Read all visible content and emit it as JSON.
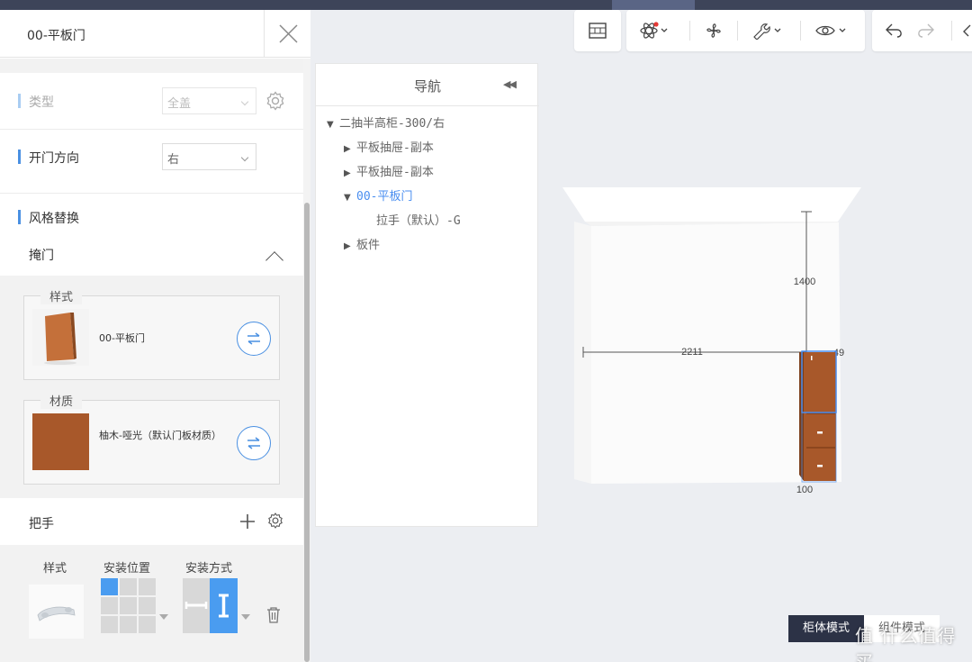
{
  "panel": {
    "title": "00-平板门",
    "rows": {
      "type": {
        "label": "类型",
        "value": "全盖"
      },
      "open_dir": {
        "label": "开门方向",
        "value": "右"
      },
      "style_replace": {
        "label": "风格替换"
      }
    },
    "overlay_door": {
      "label": "掩门"
    },
    "style_card": {
      "legend": "样式",
      "name": "00-平板门"
    },
    "material_card": {
      "legend": "材质",
      "name": "柚木-哑光（默认门板材质）"
    },
    "handle": {
      "label": "把手",
      "col_style": "样式",
      "col_position": "安装位置",
      "col_method": "安装方式"
    }
  },
  "nav": {
    "title": "导航",
    "items": [
      {
        "label": "二抽半高柜-300/右",
        "level": 0,
        "expanded": true
      },
      {
        "label": "平板抽屉-副本",
        "level": 1,
        "expanded": false
      },
      {
        "label": "平板抽屉-副本",
        "level": 1,
        "expanded": false
      },
      {
        "label": "00-平板门",
        "level": 1,
        "expanded": true,
        "active": true
      },
      {
        "label": "拉手（默认）-G",
        "level": 2
      },
      {
        "label": "板件",
        "level": 1,
        "expanded": false
      }
    ]
  },
  "scene": {
    "dim_height": "1400",
    "dim_width": "2211",
    "dim_side": "49",
    "dim_bottom": "100"
  },
  "modes": {
    "cabinet": "柜体模式",
    "component": "组件模式"
  },
  "watermark": "值 什么值得买",
  "colors": {
    "accent": "#4a90e2",
    "wood": "#a8582a",
    "toolbar_dark": "#3d4459",
    "active_tree": "#4a8ef0"
  },
  "icons": [
    "close-icon",
    "gear-icon",
    "chevron-down-icon",
    "swap-icon",
    "plus-icon",
    "trash-icon",
    "collapse-left-icon",
    "frame-icon",
    "atom-icon",
    "fan-icon",
    "wrench-icon",
    "eye-icon",
    "undo-icon",
    "redo-icon"
  ]
}
